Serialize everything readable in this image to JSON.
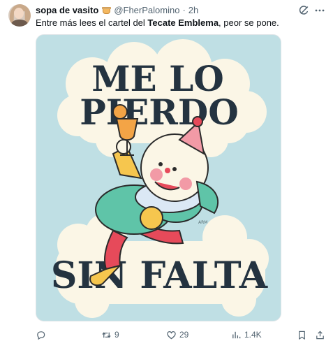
{
  "author": {
    "display_name": "sopa de vasito",
    "handle": "@FherPalomino",
    "separator": "·",
    "time": "2h"
  },
  "tweet": {
    "text_before": "Entre más lees el cartel del ",
    "text_bold": "Tecate Emblema",
    "text_after": ", peor se pone."
  },
  "media": {
    "line1": "ME LO",
    "line2": "PIERDO",
    "line3": "SIN FALTA",
    "signature": "ARM"
  },
  "actions": {
    "reply_count": "",
    "retweet_count": "9",
    "like_count": "29",
    "views_count": "1.4K"
  },
  "colors": {
    "text_primary": "#0f1419",
    "text_secondary": "#536471",
    "poster_background": "#bfdfe4",
    "poster_cloud": "#fbf6e6",
    "poster_lettering": "#243340"
  }
}
